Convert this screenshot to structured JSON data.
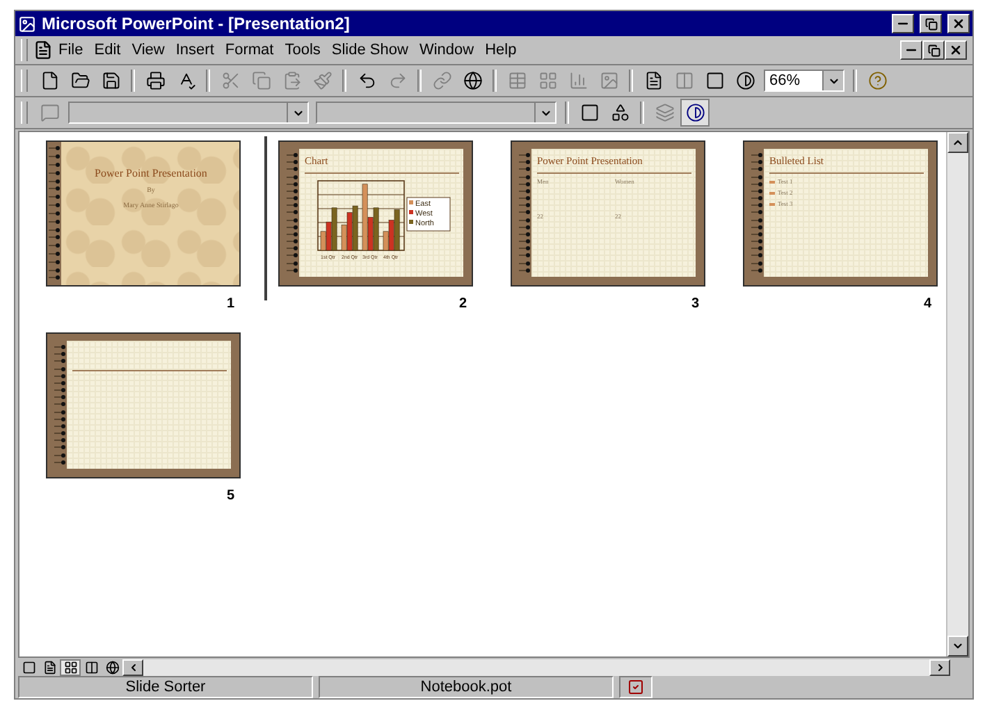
{
  "window": {
    "title": "Microsoft PowerPoint - [Presentation2]"
  },
  "menu": [
    "File",
    "Edit",
    "View",
    "Insert",
    "Format",
    "Tools",
    "Slide Show",
    "Window",
    "Help"
  ],
  "toolbar": {
    "zoom": "66%"
  },
  "slides": [
    {
      "number": "1",
      "kind": "title",
      "title": "Power Point Presentation",
      "subtitle": [
        "By",
        "Mary Anne Stirlago"
      ],
      "insertion_point": true
    },
    {
      "number": "2",
      "kind": "chart",
      "title": "Chart",
      "categories": [
        "1st Qtr",
        "2nd Qtr",
        "3rd Qtr",
        "4th Qtr"
      ],
      "legend": [
        "East",
        "West",
        "North"
      ],
      "insertion_point": false
    },
    {
      "number": "3",
      "kind": "table",
      "title": "Power Point Presentation",
      "columns": [
        {
          "header": "Men",
          "value": "22"
        },
        {
          "header": "Women",
          "value": "22"
        }
      ],
      "insertion_point": false
    },
    {
      "number": "4",
      "kind": "bullets",
      "title": "Bulleted List",
      "bullets": [
        "Test 1",
        "Test 2",
        "Test 3"
      ],
      "insertion_point": false
    },
    {
      "number": "5",
      "kind": "blank",
      "insertion_point": false
    }
  ],
  "view_buttons": [
    {
      "kind": "normal",
      "selected": false
    },
    {
      "kind": "outline",
      "selected": false
    },
    {
      "kind": "sorter",
      "selected": true
    },
    {
      "kind": "notes",
      "selected": false
    },
    {
      "kind": "show",
      "selected": false
    }
  ],
  "status_bar": {
    "sections": [
      "Slide Sorter",
      "Notebook.pot"
    ]
  }
}
